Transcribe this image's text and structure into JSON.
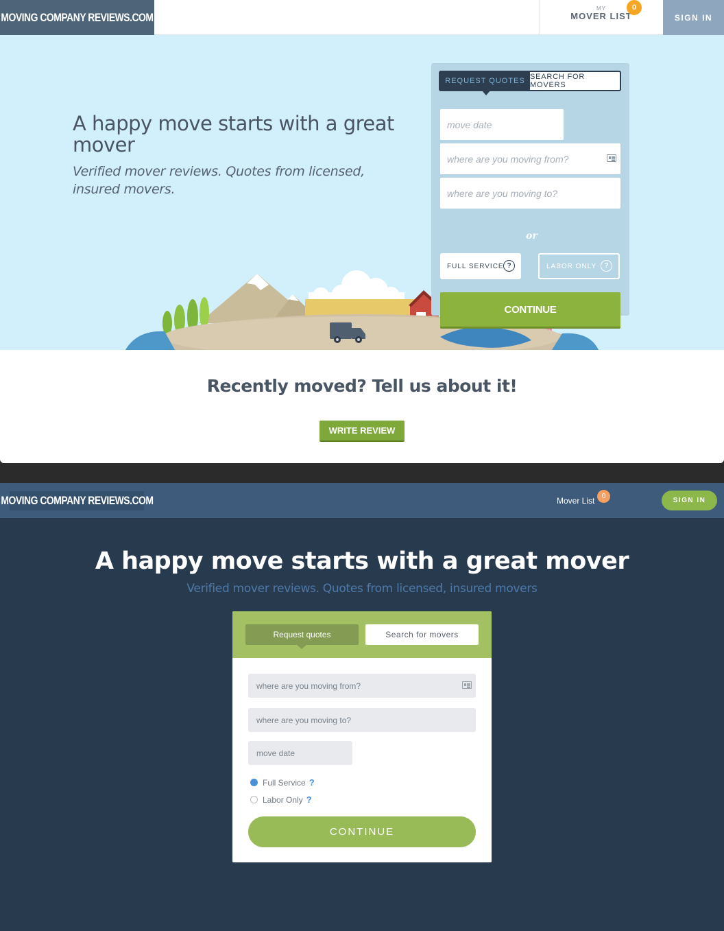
{
  "top": {
    "header": {
      "logo": "MOVING COMPANY REVIEWS.COM",
      "mover_list_small": "MY",
      "mover_list_label": "MOVER LIST",
      "mover_list_count": "0",
      "sign_in": "SIGN IN"
    },
    "hero": {
      "title": "A happy move starts with a great mover",
      "subtitle": "Verified mover reviews. Quotes from licensed, insured movers."
    },
    "form": {
      "tab_active": "REQUEST QUOTES",
      "tab_other": "SEARCH FOR MOVERS",
      "move_date_placeholder": "move date",
      "from_placeholder": "where are you moving from?",
      "to_placeholder": "where are you moving to?",
      "full_service": "FULL SERVICE",
      "labor_only": "LABOR ONLY",
      "help": "?",
      "or": "or",
      "continue": "CONTINUE"
    },
    "review": {
      "heading": "Recently moved? Tell us about it!",
      "button": "WRITE REVIEW"
    }
  },
  "bottom": {
    "header": {
      "logo": "MOVING COMPANY REVIEWS.COM",
      "mover_list": "Mover List",
      "mover_list_count": "0",
      "sign_in": "SIGN IN"
    },
    "hero": {
      "title": "A happy move starts with a great mover",
      "subtitle": "Verified mover reviews. Quotes from licensed, insured movers"
    },
    "form": {
      "tab_active": "Request quotes",
      "tab_other": "Search for movers",
      "from_placeholder": "where are you moving from?",
      "to_placeholder": "where are you moving to?",
      "move_date_placeholder": "move date",
      "full_service": "Full Service",
      "labor_only": "Labor Only",
      "help": "?",
      "selected_service": "Full Service",
      "continue": "CONTINUE"
    }
  },
  "colors": {
    "top_logo_bg": "#4e6478",
    "hero_bg": "#d2f0fb",
    "green": "#8db33f",
    "badge": "#f5a623",
    "bottom_bg": "#283a4e",
    "bottom_header": "#3f5b7b"
  },
  "icons": [
    "address-book-icon",
    "help-icon",
    "truck-icon"
  ]
}
